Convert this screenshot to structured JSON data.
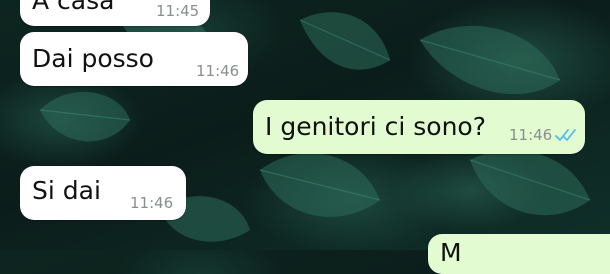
{
  "chat": {
    "messages": [
      {
        "direction": "incoming",
        "text": "A casa",
        "time": "11:45"
      },
      {
        "direction": "incoming",
        "text": "Dai posso",
        "time": "11:46"
      },
      {
        "direction": "outgoing",
        "text": "I genitori ci sono?",
        "time": "11:46",
        "status_icon": "double-check-read-icon"
      },
      {
        "direction": "incoming",
        "text": "Si dai",
        "time": "11:46"
      },
      {
        "direction": "outgoing",
        "text": "M",
        "time": ""
      }
    ]
  },
  "colors": {
    "incoming_bubble": "#ffffff",
    "outgoing_bubble": "#e3fbd1",
    "timestamp": "#8a8f8c",
    "read_ticks": "#53bdeb"
  }
}
